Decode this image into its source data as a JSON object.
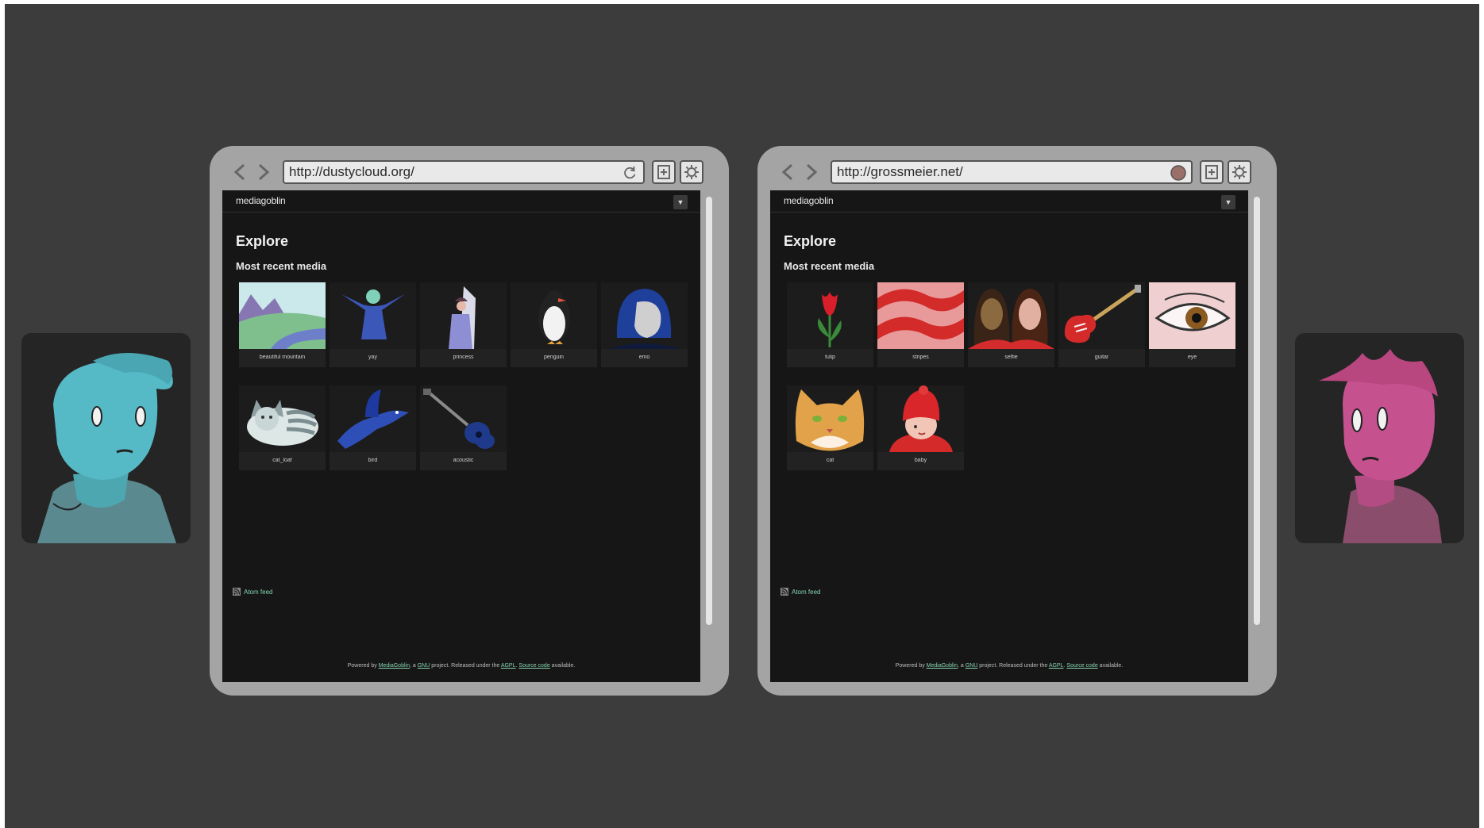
{
  "browsers": [
    {
      "url": "http://dustycloud.org/",
      "status_icon": "reload-icon",
      "site_name": "mediagoblin",
      "explore_title": "Explore",
      "recent_title": "Most recent media",
      "tiles": [
        {
          "label": "beautiful mountain",
          "icon": "mountain-landscape"
        },
        {
          "label": "yay",
          "icon": "cheering-figure"
        },
        {
          "label": "princess",
          "icon": "princess"
        },
        {
          "label": "penguin",
          "icon": "penguin"
        },
        {
          "label": "emo",
          "icon": "emo-face"
        },
        {
          "label": "cat_loaf",
          "icon": "cat-loaf"
        },
        {
          "label": "bird",
          "icon": "blue-bird"
        },
        {
          "label": "acoustic",
          "icon": "acoustic-guitar"
        }
      ],
      "atom_feed": "Atom feed",
      "footer": {
        "powered": "Powered by",
        "mediagoblin": "MediaGoblin",
        "a": ", a",
        "gnu": "GNU",
        "project": "project. Released under the",
        "agpl": "AGPL",
        "dot": ".",
        "source": "Source code",
        "available": "available."
      }
    },
    {
      "url": "http://grossmeier.net/",
      "status_icon": "loading-dot-icon",
      "site_name": "mediagoblin",
      "explore_title": "Explore",
      "recent_title": "Most recent media",
      "tiles": [
        {
          "label": "tulip",
          "icon": "tulip"
        },
        {
          "label": "stripes",
          "icon": "red-stripes"
        },
        {
          "label": "selfie",
          "icon": "two-women"
        },
        {
          "label": "guitar",
          "icon": "electric-guitar"
        },
        {
          "label": "eye",
          "icon": "eye"
        },
        {
          "label": "cat",
          "icon": "cat-face"
        },
        {
          "label": "baby",
          "icon": "baby-red-hat"
        }
      ],
      "atom_feed": "Atom feed",
      "footer": {
        "powered": "Powered by",
        "mediagoblin": "MediaGoblin",
        "a": ", a",
        "gnu": "GNU",
        "project": "project. Released under the",
        "agpl": "AGPL",
        "dot": ".",
        "source": "Source code",
        "available": "available."
      }
    }
  ],
  "avatars": [
    {
      "icon": "cyan-person-avatar",
      "color": "#56b9c6"
    },
    {
      "icon": "pink-person-avatar",
      "color": "#c5528f"
    }
  ],
  "colors": {
    "stage": "#3c3c3c",
    "frame": "#a4a4a4",
    "viewport": "#161616",
    "link": "#86d4b1"
  }
}
